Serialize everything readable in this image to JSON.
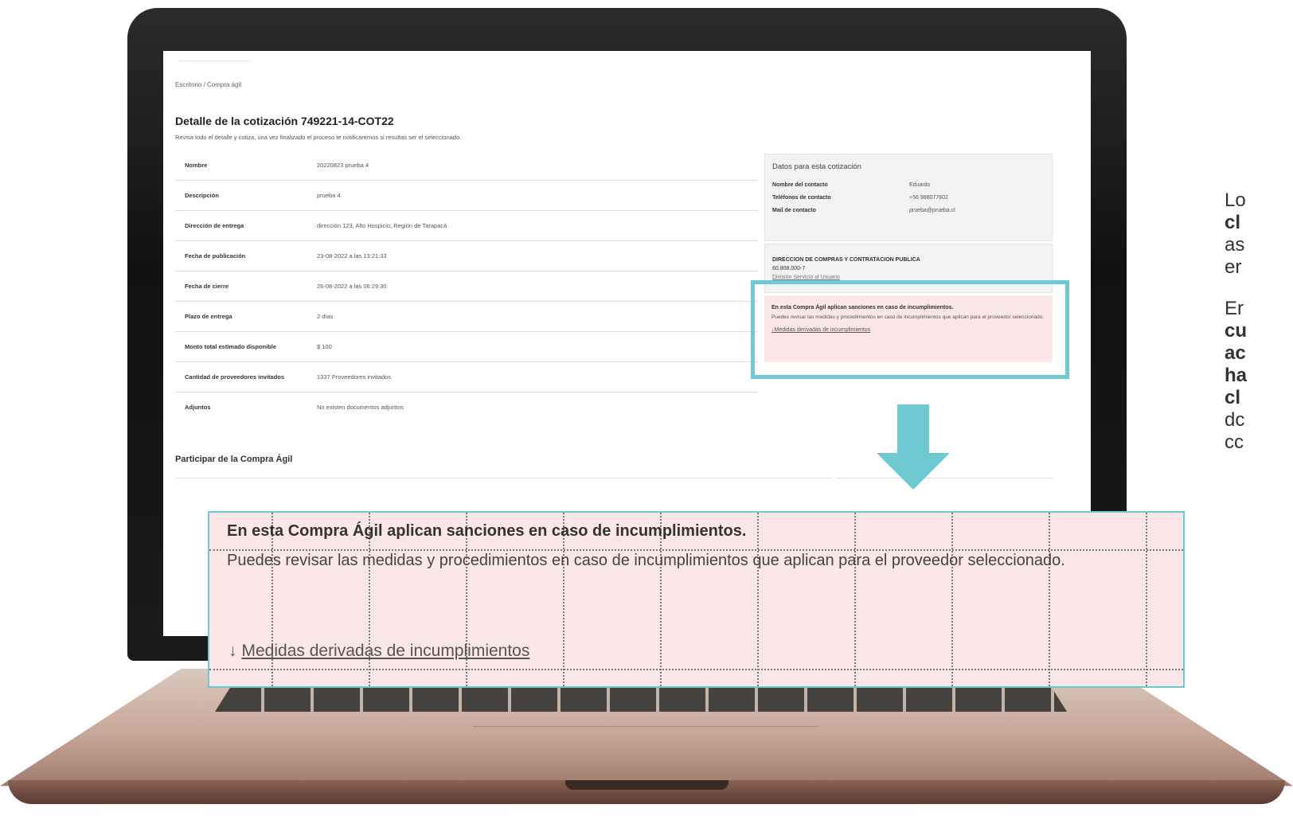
{
  "breadcrumb": "Escritorio / Compra ágil",
  "title": "Detalle de la cotización 749221-14-COT22",
  "subtitle": "Revisa todo el detalle y cotiza, una vez finalizado el proceso te notificaremos si resultas ser el seleccionado.",
  "details": [
    {
      "label": "Nombre",
      "value": "20220823 prueba 4"
    },
    {
      "label": "Descripción",
      "value": "prueba 4"
    },
    {
      "label": "Dirección de entrega",
      "value": "dirección 123, Alto Hospicio, Región de Tarapacá"
    },
    {
      "label": "Fecha de publicación",
      "value": "23-08-2022 a las 13:21:33"
    },
    {
      "label": "Fecha de cierre",
      "value": "26-08-2022 a las 06:29:30"
    },
    {
      "label": "Plazo de entrega",
      "value": "2 días"
    },
    {
      "label": "Monto total estimado disponible",
      "value": "$ 100"
    },
    {
      "label": "Cantidad de proveedores invitados",
      "value": "1337 Proveedores invitados"
    },
    {
      "label": "Adjuntos",
      "value": "No existen documentos adjuntos"
    }
  ],
  "contact": {
    "heading": "Datos para esta cotización",
    "name_label": "Nombre del contacto",
    "name_value": "Eduardo",
    "phone_label": "Teléfonos de contacto",
    "phone_value": "+56 988077802",
    "mail_label": "Mail de contacto",
    "mail_value": "prueba@prueba.cl"
  },
  "organization": {
    "name": "DIRECCION DE COMPRAS Y CONTRATACION PUBLICA",
    "rut": "60.808.000-7",
    "division": "División Servicio al Usuario"
  },
  "sanctions": {
    "title": "En esta Compra Ágil aplican sanciones en caso de incumplimientos.",
    "text": "Puedes revisar las medidas y procedimientos en caso de incumplimientos que aplican para el proveedor seleccionado.",
    "link": "Medidas derivadas de incumplimientos",
    "arrow_glyph": "↓"
  },
  "participate": "Participar de la Compra Ágil",
  "right_text": {
    "p1_a": "Lo",
    "p1_b": "cl",
    "p1_c": "as",
    "p1_d": "er",
    "p2_a": "Er",
    "p2_b": "cu",
    "p2_c": "ac",
    "p2_d": "ha",
    "p2_e": "cl",
    "p2_f": "dc",
    "p2_g": "cc"
  },
  "colors": {
    "accent": "#6ec9d3",
    "alert_bg": "#fbe6e8"
  }
}
